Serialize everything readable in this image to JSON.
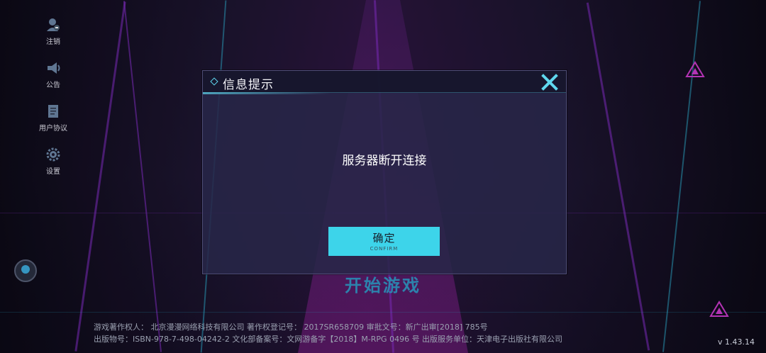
{
  "sidebar": {
    "items": [
      {
        "label": "注销",
        "icon": "user-logout-icon"
      },
      {
        "label": "公告",
        "icon": "megaphone-icon"
      },
      {
        "label": "用户协议",
        "icon": "document-icon"
      },
      {
        "label": "设置",
        "icon": "gear-icon"
      }
    ]
  },
  "dialog": {
    "title": "信息提示",
    "message": "服务器断开连接",
    "confirm_label": "确定",
    "confirm_sublabel": "CONFIRM"
  },
  "start_game": "开始游戏",
  "footer": {
    "line1": "游戏著作权人：  北京漫漫网络科技有限公司      著作权登记号： 2017SR658709      审批文号：新广出审[2018]  785号",
    "line2": "出版物号：ISBN-978-7-498-04242-2     文化部备案号：文网游备字【2018】M-RPG 0496 号     出版服务单位：天津电子出版社有限公司"
  },
  "version": "v 1.43.14",
  "colors": {
    "accent": "#3dd4ea",
    "start_text": "#2fa6d2",
    "dialog_bg": "#28264a",
    "neon": "#8a2fd0"
  }
}
